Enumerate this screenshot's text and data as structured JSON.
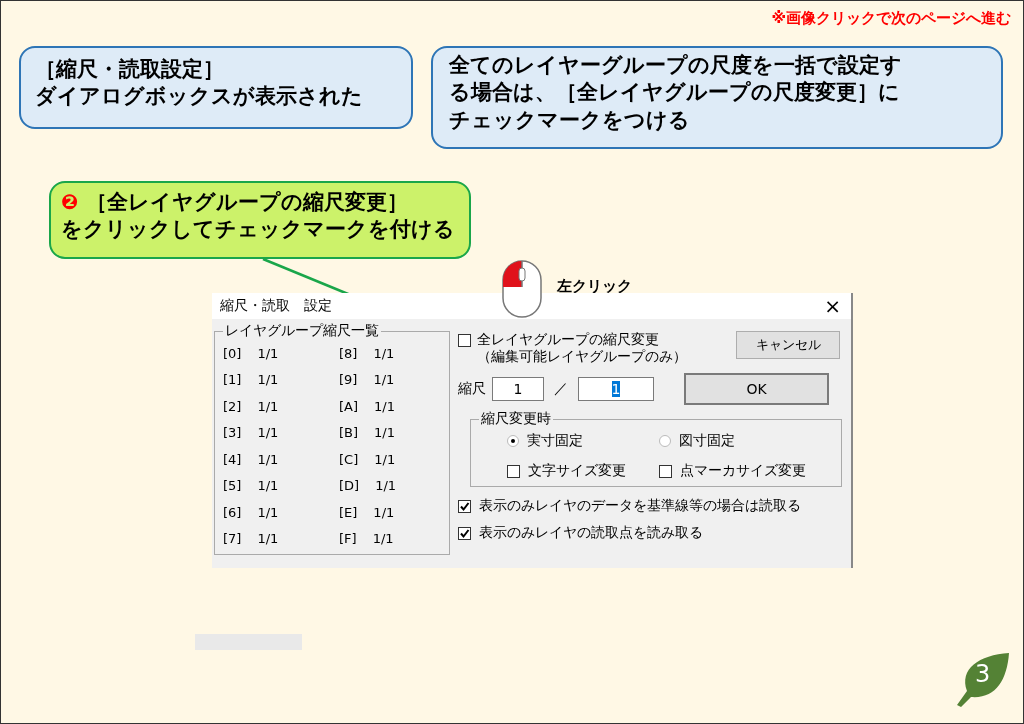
{
  "notice": "※画像クリックで次のページへ進む",
  "callouts": [
    {
      "kind": "info",
      "lines": [
        "［縮尺・読取設定］",
        "ダイアログボックスが表示された"
      ]
    },
    {
      "kind": "info",
      "lines": [
        "全てのレイヤーグループの尺度を一括で設定す",
        "る場合は、［全レイヤグループの尺度変更］に",
        "チェックマークをつける"
      ]
    },
    {
      "kind": "step",
      "step": "❷",
      "lines": [
        "［全レイヤグループの縮尺変更］",
        "をクリックしてチェックマークを付ける"
      ]
    }
  ],
  "mouse_label": "左クリック",
  "dialog": {
    "title": "縮尺・読取　設定",
    "close": "×",
    "group_title": "レイヤグループ縮尺一覧",
    "scales": [
      {
        "label": "[0]",
        "value": "1/1"
      },
      {
        "label": "[1]",
        "value": "1/1"
      },
      {
        "label": "[2]",
        "value": "1/1"
      },
      {
        "label": "[3]",
        "value": "1/1"
      },
      {
        "label": "[4]",
        "value": "1/1"
      },
      {
        "label": "[5]",
        "value": "1/1"
      },
      {
        "label": "[6]",
        "value": "1/1"
      },
      {
        "label": "[7]",
        "value": "1/1"
      },
      {
        "label": "[8]",
        "value": "1/1"
      },
      {
        "label": "[9]",
        "value": "1/1"
      },
      {
        "label": "[A]",
        "value": "1/1"
      },
      {
        "label": "[B]",
        "value": "1/1"
      },
      {
        "label": "[C]",
        "value": "1/1"
      },
      {
        "label": "[D]",
        "value": "1/1"
      },
      {
        "label": "[E]",
        "value": "1/1"
      },
      {
        "label": "[F]",
        "value": "1/1"
      }
    ],
    "all_change": {
      "label": "全レイヤグループの縮尺変更",
      "note": "（編集可能レイヤグループのみ）",
      "checked": false
    },
    "cancel": "キャンセル",
    "scale_label": "縮尺",
    "numerator": "1",
    "separator": "／",
    "denominator": {
      "value": "1",
      "selected": true
    },
    "ok": "OK",
    "frame_title": "縮尺変更時",
    "radios": [
      {
        "label": "実寸固定",
        "selected": true
      },
      {
        "label": "図寸固定",
        "selected": false
      }
    ],
    "size_options": [
      {
        "label": "文字サイズ変更",
        "checked": false
      },
      {
        "label": "点マーカサイズ変更",
        "checked": false
      }
    ],
    "options": [
      {
        "label": "表示のみレイヤのデータを基準線等の場合は読取る",
        "checked": true
      },
      {
        "label": "表示のみレイヤの読取点を読み取る",
        "checked": true
      }
    ]
  },
  "page_number": "3"
}
